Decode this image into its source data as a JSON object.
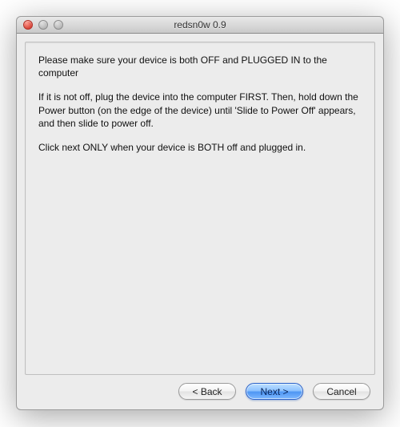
{
  "window": {
    "title": "redsn0w 0.9"
  },
  "instructions": {
    "p1": "Please make sure your device is both OFF and PLUGGED IN to the computer",
    "p2": "If it is not off, plug the device into the computer FIRST. Then, hold down the Power button (on the edge of the device) until 'Slide to Power Off' appears, and then slide to power off.",
    "p3": "Click next ONLY when your device is BOTH off and plugged in."
  },
  "buttons": {
    "back": "< Back",
    "next": "Next >",
    "cancel": "Cancel"
  }
}
